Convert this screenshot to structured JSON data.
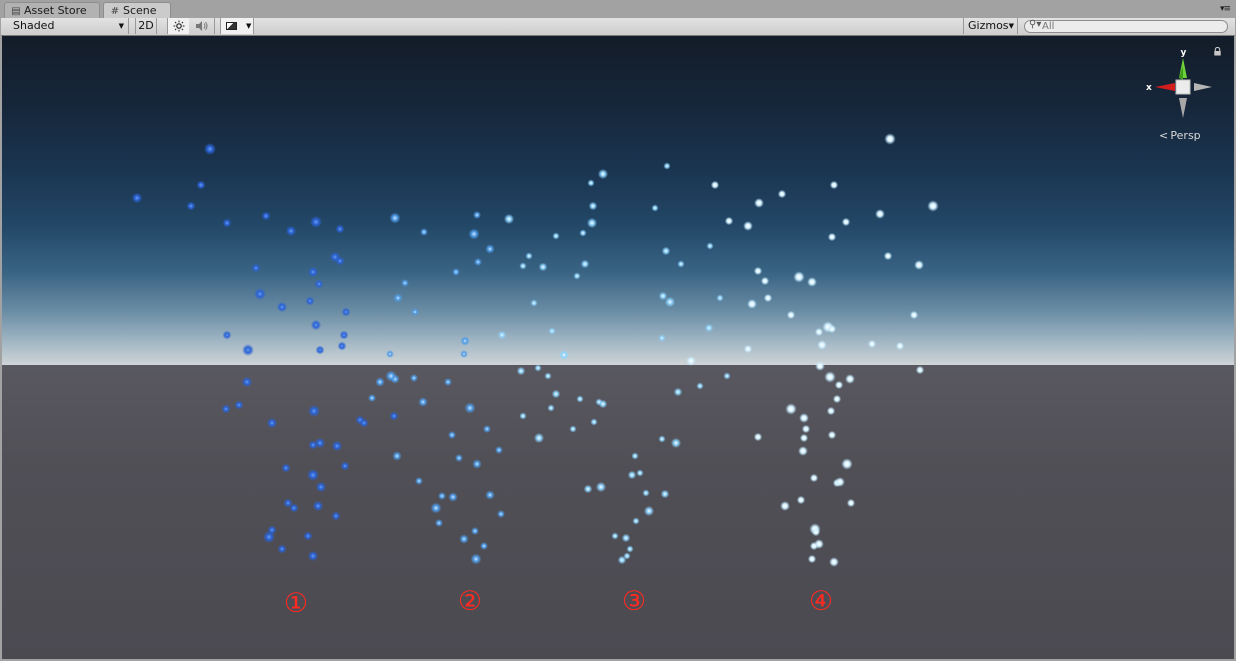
{
  "tabs": [
    {
      "label": "Asset Store",
      "icon": "asset-store-icon"
    },
    {
      "label": "Scene",
      "icon": "scene-grid-icon"
    }
  ],
  "toolbar": {
    "shading_mode": "Shaded",
    "mode_2d": "2D",
    "gizmos_label": "Gizmos",
    "search_placeholder": "All"
  },
  "scene": {
    "projection_label": "Persp",
    "axis_labels": {
      "y": "y",
      "x": "x"
    },
    "sky_horizon_color": "#cfd4d6",
    "sky_top_color": "#131c28",
    "ground_color": "#4e4d51",
    "groups": [
      {
        "label": "①",
        "particle_color": "#2f6fe0"
      },
      {
        "label": "②",
        "particle_color": "#5aa8f0"
      },
      {
        "label": "③",
        "particle_color": "#9fdcff"
      },
      {
        "label": "④",
        "particle_color": "#e8f8ff"
      }
    ],
    "label_color": "#ff2a22"
  }
}
